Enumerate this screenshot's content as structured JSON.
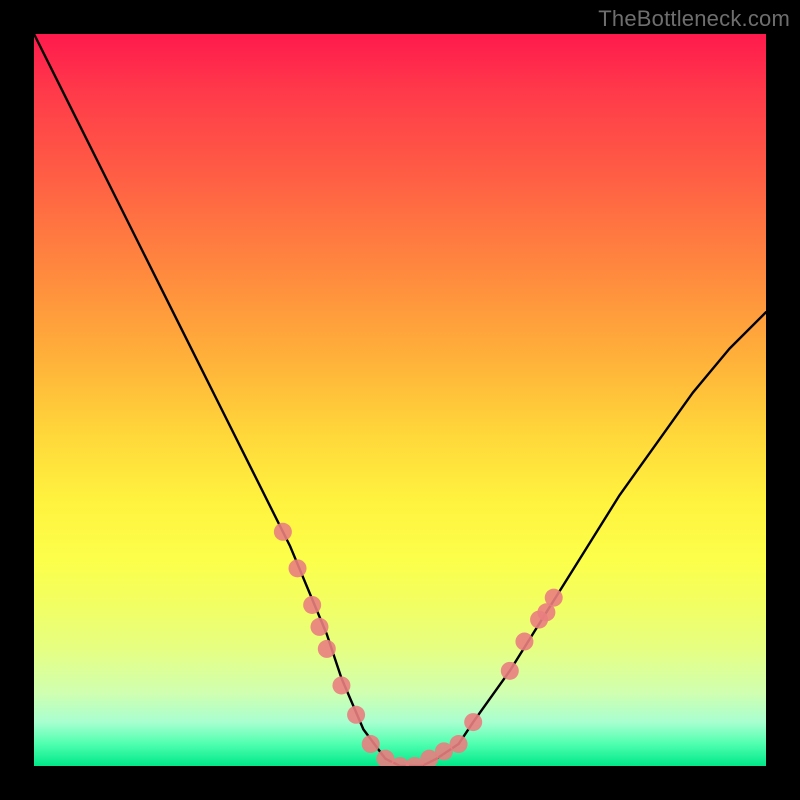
{
  "watermark": "TheBottleneck.com",
  "chart_data": {
    "type": "line",
    "title": "",
    "xlabel": "",
    "ylabel": "",
    "xlim": [
      0,
      100
    ],
    "ylim": [
      0,
      100
    ],
    "grid": false,
    "legend": false,
    "series": [
      {
        "name": "bottleneck-curve",
        "x": [
          0,
          5,
          10,
          15,
          20,
          25,
          30,
          35,
          40,
          42,
          45,
          48,
          50,
          53,
          55,
          58,
          60,
          65,
          70,
          75,
          80,
          85,
          90,
          95,
          100
        ],
        "y": [
          100,
          90,
          80,
          70,
          60,
          50,
          40,
          30,
          18,
          12,
          5,
          1,
          0,
          0,
          1,
          3,
          6,
          13,
          21,
          29,
          37,
          44,
          51,
          57,
          62
        ]
      }
    ],
    "markers": [
      {
        "x": 34,
        "y": 32,
        "name": "data-point"
      },
      {
        "x": 36,
        "y": 27,
        "name": "data-point"
      },
      {
        "x": 38,
        "y": 22,
        "name": "data-point"
      },
      {
        "x": 39,
        "y": 19,
        "name": "data-point"
      },
      {
        "x": 40,
        "y": 16,
        "name": "data-point"
      },
      {
        "x": 42,
        "y": 11,
        "name": "data-point"
      },
      {
        "x": 44,
        "y": 7,
        "name": "data-point"
      },
      {
        "x": 46,
        "y": 3,
        "name": "data-point"
      },
      {
        "x": 48,
        "y": 1,
        "name": "data-point"
      },
      {
        "x": 50,
        "y": 0,
        "name": "data-point"
      },
      {
        "x": 52,
        "y": 0,
        "name": "data-point"
      },
      {
        "x": 54,
        "y": 1,
        "name": "data-point"
      },
      {
        "x": 56,
        "y": 2,
        "name": "data-point"
      },
      {
        "x": 58,
        "y": 3,
        "name": "data-point"
      },
      {
        "x": 60,
        "y": 6,
        "name": "data-point"
      },
      {
        "x": 65,
        "y": 13,
        "name": "data-point"
      },
      {
        "x": 67,
        "y": 17,
        "name": "data-point"
      },
      {
        "x": 69,
        "y": 20,
        "name": "data-point"
      },
      {
        "x": 70,
        "y": 21,
        "name": "data-point"
      },
      {
        "x": 71,
        "y": 23,
        "name": "data-point"
      }
    ],
    "marker_color": "#e97e80",
    "curve_color": "#000000",
    "gradient_stops": [
      {
        "pos": 0.0,
        "color": "#ff1a4d"
      },
      {
        "pos": 0.5,
        "color": "#ffd33a"
      },
      {
        "pos": 0.75,
        "color": "#fcff4a"
      },
      {
        "pos": 1.0,
        "color": "#00e888"
      }
    ]
  }
}
